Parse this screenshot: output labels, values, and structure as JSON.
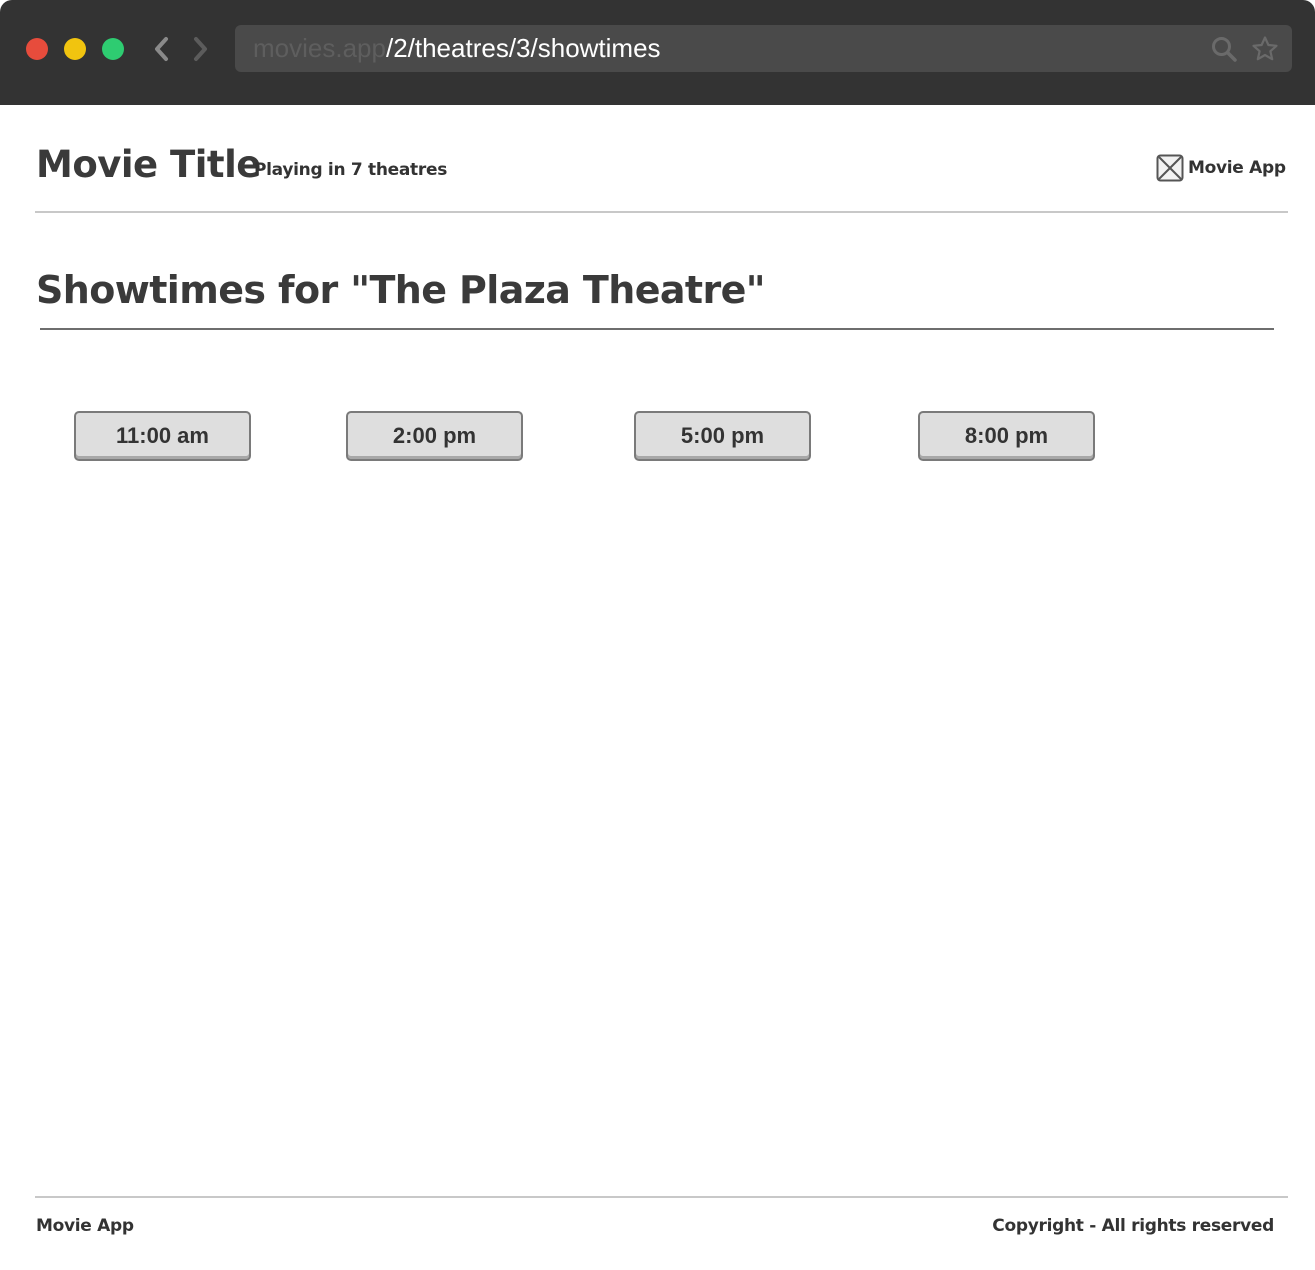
{
  "browser": {
    "url_host": "movies.app",
    "url_path": "/2/theatres/3/showtimes",
    "window_buttons": {
      "close": "#e74c3c",
      "minimize": "#f1c40f",
      "maximize": "#2ecc71"
    }
  },
  "header": {
    "title": "Movie Title",
    "subtitle": "Playing in 7 theatres",
    "brand_label": "Movie App",
    "brand_icon": "image-placeholder-icon"
  },
  "main": {
    "heading": "Showtimes for \"The Plaza Theatre\"",
    "showtimes": [
      "11:00 am",
      "2:00 pm",
      "5:00 pm",
      "8:00 pm"
    ]
  },
  "footer": {
    "brand": "Movie App",
    "copyright": "Copyright - All rights reserved"
  }
}
